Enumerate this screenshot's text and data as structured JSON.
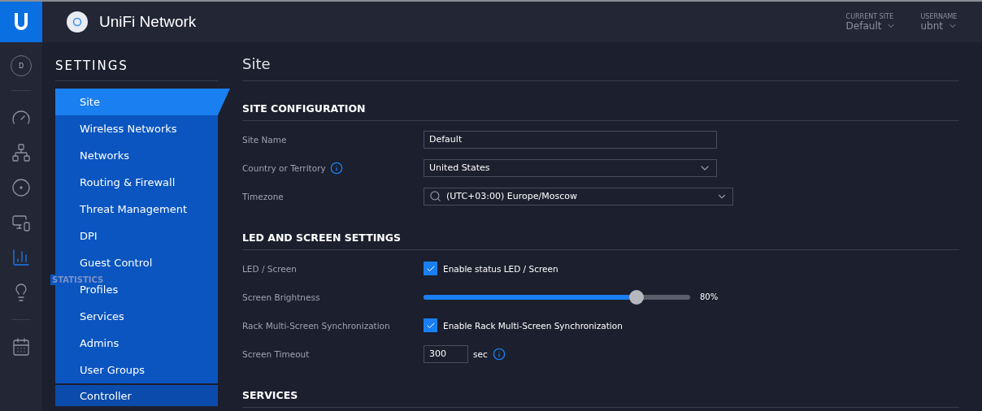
{
  "header": {
    "brand": "UniFi Network",
    "current_site": {
      "label": "CURRENT SITE",
      "value": "Default"
    },
    "username": {
      "label": "USERNAME",
      "value": "ubnt"
    }
  },
  "rail": {
    "avatar": "D",
    "items": [
      {
        "kind": "dashboard",
        "selected": false
      },
      {
        "kind": "topology",
        "selected": false
      },
      {
        "kind": "devices",
        "selected": false
      },
      {
        "kind": "clients",
        "selected": false
      },
      {
        "kind": "statistics",
        "selected": true
      },
      {
        "kind": "insights",
        "selected": false
      },
      {
        "kind": "events",
        "selected": false
      }
    ],
    "tooltip": "STATISTICS"
  },
  "settings": {
    "title": "SETTINGS",
    "items": [
      {
        "label": "Site",
        "selected": true
      },
      {
        "label": "Wireless Networks",
        "selected": false
      },
      {
        "label": "Networks",
        "selected": false
      },
      {
        "label": "Routing & Firewall",
        "selected": false
      },
      {
        "label": "Threat Management",
        "selected": false
      },
      {
        "label": "DPI",
        "selected": false
      },
      {
        "label": "Guest Control",
        "selected": false
      },
      {
        "label": "Profiles",
        "selected": false
      },
      {
        "label": "Services",
        "selected": false
      },
      {
        "label": "Admins",
        "selected": false
      },
      {
        "label": "User Groups",
        "selected": false
      }
    ],
    "next_group": "Controller"
  },
  "page": {
    "title": "Site",
    "sections": [
      {
        "title": "SITE CONFIGURATION",
        "rows": [
          {
            "kind": "text",
            "label": "Site Name",
            "value": "Default"
          },
          {
            "kind": "select",
            "label": "Country or Territory",
            "info": true,
            "value": "United States"
          },
          {
            "kind": "search_select",
            "label": "Timezone",
            "value": "(UTC+03:00) Europe/Moscow"
          }
        ]
      },
      {
        "title": "LED AND SCREEN SETTINGS",
        "rows": [
          {
            "kind": "checkbox",
            "label": "LED / Screen",
            "checked": true,
            "text": "Enable status LED / Screen"
          },
          {
            "kind": "slider",
            "label": "Screen Brightness",
            "level": 0.8,
            "reading": "80%"
          },
          {
            "kind": "checkbox",
            "label": "Rack Multi-Screen Synchronization",
            "checked": true,
            "text": "Enable Rack Multi-Screen Synchronization"
          },
          {
            "kind": "number",
            "label": "Screen Timeout",
            "value": "300",
            "unit": "sec",
            "info": true
          }
        ]
      },
      {
        "title": "SERVICES"
      }
    ]
  }
}
